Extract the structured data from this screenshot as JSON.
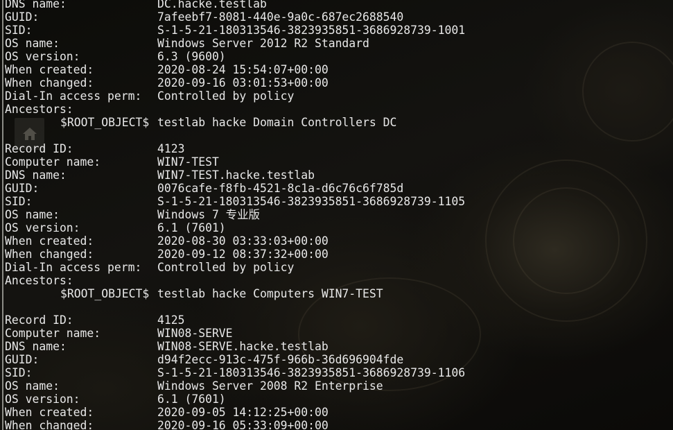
{
  "terminal": {
    "blocks": [
      {
        "rows": [
          {
            "label": "DNS name:",
            "value": "DC.hacke.testlab"
          },
          {
            "label": "GUID:",
            "value": "7afeebf7-8081-440e-9a0c-687ec2688540"
          },
          {
            "label": "SID:",
            "value": "S-1-5-21-180313546-3823935851-3686928739-1001"
          },
          {
            "label": "OS name:",
            "value": "Windows Server 2012 R2 Standard"
          },
          {
            "label": "OS version:",
            "value": "6.3 (9600)"
          },
          {
            "label": "When created:",
            "value": "2020-08-24 15:54:07+00:00"
          },
          {
            "label": "When changed:",
            "value": "2020-09-16 03:01:53+00:00"
          },
          {
            "label": "Dial-In access perm:",
            "value": "Controlled by policy"
          },
          {
            "label": "Ancestors:",
            "value": ""
          }
        ],
        "ancestor": {
          "key": "$ROOT_OBJECT$",
          "path": "testlab hacke Domain Controllers DC"
        }
      },
      {
        "rows": [
          {
            "label": "Record ID:",
            "value": "4123"
          },
          {
            "label": "Computer name:",
            "value": "WIN7-TEST"
          },
          {
            "label": "DNS name:",
            "value": "WIN7-TEST.hacke.testlab"
          },
          {
            "label": "GUID:",
            "value": "0076cafe-f8fb-4521-8c1a-d6c76c6f785d"
          },
          {
            "label": "SID:",
            "value": "S-1-5-21-180313546-3823935851-3686928739-1105"
          },
          {
            "label": "OS name:",
            "value": "Windows 7 专业版"
          },
          {
            "label": "OS version:",
            "value": "6.1 (7601)"
          },
          {
            "label": "When created:",
            "value": "2020-08-30 03:33:03+00:00"
          },
          {
            "label": "When changed:",
            "value": "2020-09-12 08:37:32+00:00"
          },
          {
            "label": "Dial-In access perm:",
            "value": "Controlled by policy"
          },
          {
            "label": "Ancestors:",
            "value": ""
          }
        ],
        "ancestor": {
          "key": "$ROOT_OBJECT$",
          "path": "testlab hacke Computers WIN7-TEST"
        }
      },
      {
        "rows": [
          {
            "label": "Record ID:",
            "value": "4125"
          },
          {
            "label": "Computer name:",
            "value": "WIN08-SERVE"
          },
          {
            "label": "DNS name:",
            "value": "WIN08-SERVE.hacke.testlab"
          },
          {
            "label": "GUID:",
            "value": "d94f2ecc-913c-475f-966b-36d696904fde"
          },
          {
            "label": "SID:",
            "value": "S-1-5-21-180313546-3823935851-3686928739-1106"
          },
          {
            "label": "OS name:",
            "value": "Windows Server 2008 R2 Enterprise"
          },
          {
            "label": "OS version:",
            "value": "6.1 (7601)"
          },
          {
            "label": "When created:",
            "value": "2020-09-05 14:12:25+00:00"
          },
          {
            "label": "When changed:",
            "value": "2020-09-16 05:33:09+00:00"
          }
        ]
      }
    ]
  }
}
